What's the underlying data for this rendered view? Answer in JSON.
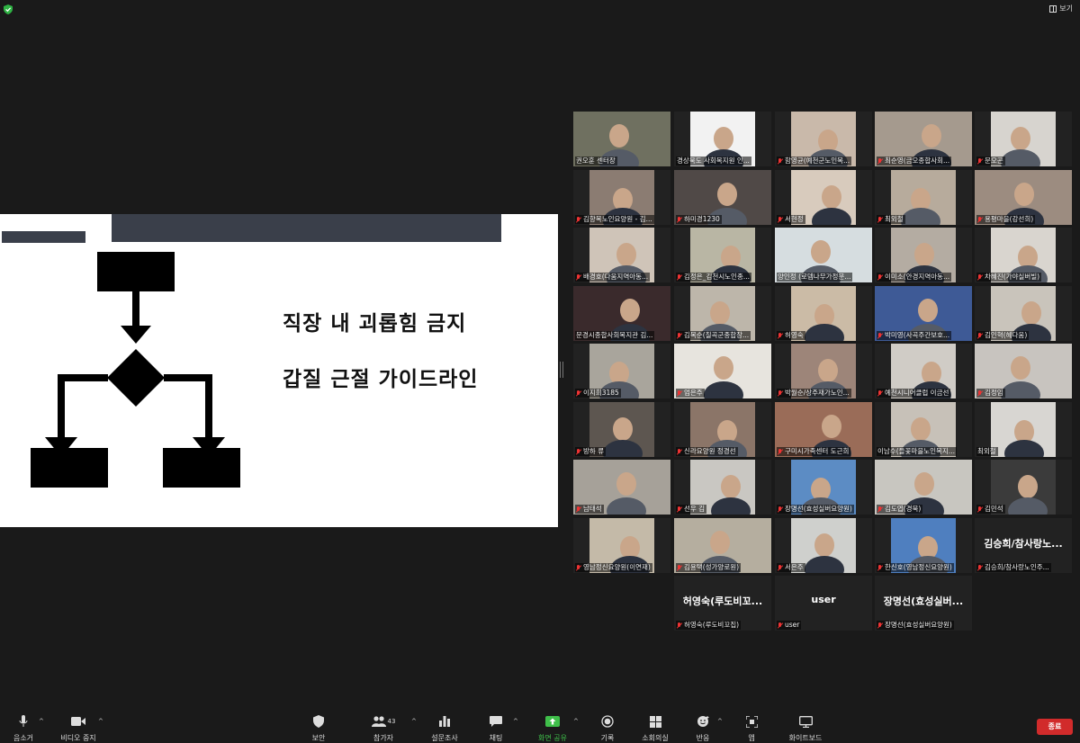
{
  "topbar": {
    "view_label": "보기"
  },
  "slide": {
    "line1": "직장 내 괴롭힘 금지",
    "line2": "갑질 근절 가이드라인"
  },
  "participants": [
    {
      "name": "권오훈 센터장",
      "muted": false,
      "active": true,
      "video": "#6f7060"
    },
    {
      "name": "경상북도 사회복지원 인...",
      "muted": false,
      "active": false,
      "video": "#f2f2f2"
    },
    {
      "name": "함영균(예천군노인복...",
      "muted": true,
      "active": false,
      "video": "#c9b9aa"
    },
    {
      "name": "최순영(금오종합사회...",
      "muted": true,
      "active": false,
      "video": "#a59a8e"
    },
    {
      "name": "문오곤",
      "muted": true,
      "active": false,
      "video": "#d7d4cf"
    },
    {
      "name": "김향복노인요양원 - 김...",
      "muted": true,
      "active": false,
      "video": "#8b7c72"
    },
    {
      "name": "하미경1230",
      "muted": true,
      "active": false,
      "video": "#504947"
    },
    {
      "name": "서현정",
      "muted": true,
      "active": false,
      "video": "#d8cbbd"
    },
    {
      "name": "최외철",
      "muted": true,
      "active": false,
      "video": "#b7ab9c"
    },
    {
      "name": "용평마을(강선희)",
      "muted": true,
      "active": false,
      "video": "#9c8c80"
    },
    {
      "name": "배경호(다움지역아동...",
      "muted": true,
      "active": false,
      "video": "#cfc4b8"
    },
    {
      "name": "김정은_김천시노인종...",
      "muted": true,
      "active": false,
      "video": "#b9b6a4"
    },
    {
      "name": "양인정 (로뎀나무가정문...",
      "muted": false,
      "active": false,
      "video": "#d6dde0"
    },
    {
      "name": "이미소(안경지역아동...",
      "muted": true,
      "active": false,
      "video": "#b4aca2"
    },
    {
      "name": "차혜진(가야실버빌)",
      "muted": true,
      "active": false,
      "video": "#d9d5cf"
    },
    {
      "name": "문경시종합사회복지관 김...",
      "muted": false,
      "active": false,
      "video": "#3a2a2c"
    },
    {
      "name": "김복순(칠곡군종합장...",
      "muted": true,
      "active": false,
      "video": "#bdb6aa"
    },
    {
      "name": "허영숙",
      "muted": true,
      "active": false,
      "video": "#cbbba6"
    },
    {
      "name": "박미영(사곡주간보호...",
      "muted": true,
      "active": false,
      "video": "#3e5a96"
    },
    {
      "name": "김인혁(혜다움)",
      "muted": true,
      "active": false,
      "video": "#c9c4bb"
    },
    {
      "name": "이지희3185",
      "muted": true,
      "active": false,
      "video": "#a9a59c"
    },
    {
      "name": "엄은주",
      "muted": true,
      "active": false,
      "video": "#e7e4de"
    },
    {
      "name": "박월순/상주재가노인...",
      "muted": true,
      "active": false,
      "video": "#9d8579"
    },
    {
      "name": "예천시니어클럽 이금선",
      "muted": true,
      "active": false,
      "video": "#d0ccc6"
    },
    {
      "name": "김정임",
      "muted": true,
      "active": false,
      "video": "#c8c4bf"
    },
    {
      "name": "방하 류",
      "muted": true,
      "active": false,
      "video": "#5d5650"
    },
    {
      "name": "신라요양원 정경선",
      "muted": true,
      "active": false,
      "video": "#8b7568"
    },
    {
      "name": "구미시가족센터 도근희",
      "muted": true,
      "active": false,
      "video": "#9a6c58"
    },
    {
      "name": "이남수(들꽃마을노인복지...",
      "muted": false,
      "active": false,
      "video": "#c7c1b8"
    },
    {
      "name": "최외철",
      "muted": false,
      "active": false,
      "video": "#d8d6d2"
    },
    {
      "name": "남태석",
      "muted": true,
      "active": false,
      "video": "#a6a199"
    },
    {
      "name": "선우 김",
      "muted": true,
      "active": false,
      "video": "#c9c7c2"
    },
    {
      "name": "장명선(효성실버요양원)",
      "muted": true,
      "active": false,
      "video": "#5c8cc4"
    },
    {
      "name": "김도엽(경북)",
      "muted": true,
      "active": false,
      "video": "#c8c6c0"
    },
    {
      "name": "김민석",
      "muted": true,
      "active": false,
      "video": "#3b3b3b"
    },
    {
      "name": "영남정신요양원(이연재)",
      "muted": true,
      "active": false,
      "video": "#c4baa8"
    },
    {
      "name": "김용택(성가양로원)",
      "muted": true,
      "active": false,
      "video": "#b5ae9f"
    },
    {
      "name": "서은주",
      "muted": true,
      "active": false,
      "video": "#cfd0cd"
    },
    {
      "name": "한신호(영남정신요양원)",
      "muted": true,
      "active": false,
      "video": "#4f7fbf"
    },
    {
      "name": "김승희/참사랑노인주...",
      "muted": true,
      "active": false,
      "video": "",
      "bigname": "김승희/참사랑노..."
    },
    {
      "name": "허영숙(루도비꼬집)",
      "muted": true,
      "active": false,
      "video": "",
      "bigname": "허영숙(루도비꼬..."
    },
    {
      "name": "user",
      "muted": true,
      "active": false,
      "video": "",
      "bigname": "user"
    },
    {
      "name": "장명선(효성실버요양원)",
      "muted": true,
      "active": false,
      "video": "",
      "bigname": "장명선(효성실버..."
    }
  ],
  "toolbar": {
    "mute": "음소거",
    "video": "비디오 중지",
    "security": "보안",
    "participants": "참가자",
    "participants_count": "43",
    "polls": "설문조사",
    "chat": "채팅",
    "share": "화면 공유",
    "record": "기록",
    "breakout": "소회의실",
    "reactions": "반응",
    "apps": "앱",
    "whiteboard": "화이트보드",
    "end": "종료"
  },
  "colors": {
    "accent_green": "#3fbf4a",
    "end_red": "#d12b2b",
    "active_speaker": "#d9e84a"
  }
}
